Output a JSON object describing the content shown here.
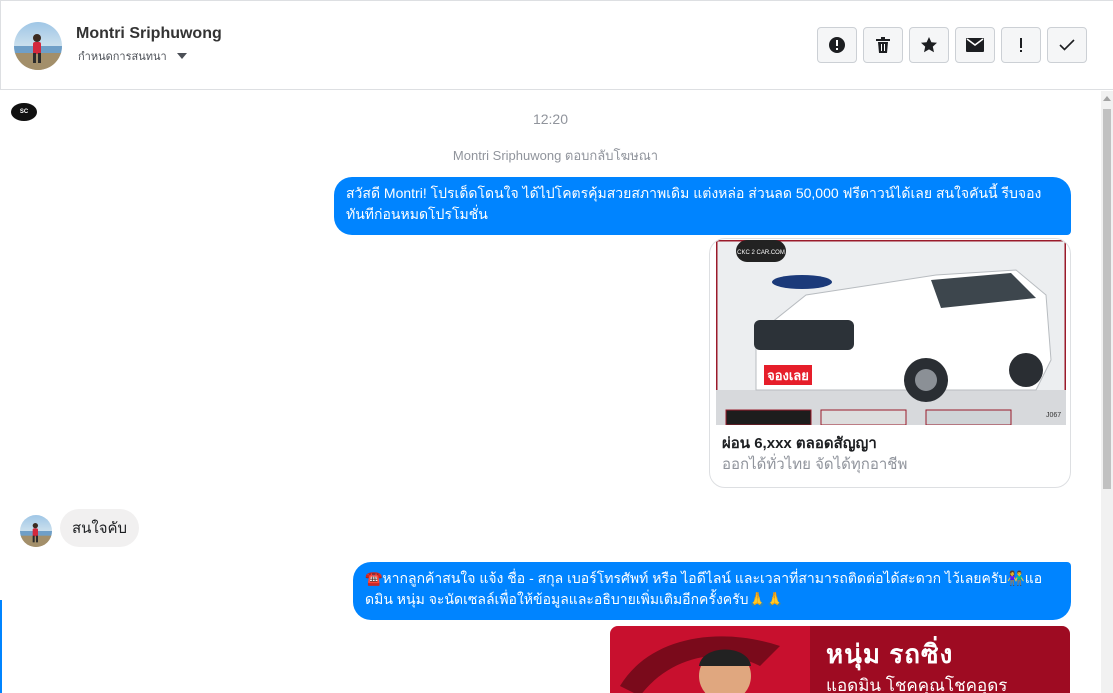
{
  "header": {
    "contact_name": "Montri Sriphuwong",
    "assign_label": "กำหนดการสนทนา",
    "actions": [
      "alert-icon",
      "trash-icon",
      "star-icon",
      "envelope-icon",
      "exclamation-icon",
      "check-icon"
    ]
  },
  "thread": {
    "page_logo": "SC",
    "time": "12:20",
    "reply_note": "Montri Sriphuwong ตอบกลับโฆษณา",
    "message1": "สวัสดี Montri! โปรเด็ดโดนใจ ได้ไปโคตรคุ้มสวยสภาพเดิม แต่งหล่อ  ส่วนลด 50,000 ฟรีดาวน์ได้เลย  สนใจคันนี้ รีบจองทันทีก่อนหมดโปรโมชั่น",
    "card": {
      "image_badge": "จองเลย",
      "image_watermark": "CKC 2 CAR.COM",
      "image_code": "J067",
      "title": "ผ่อน 6,xxx ตลอดสัญญา",
      "subtitle": "ออกได้ทั่วไทย จัดได้ทุกอาชีพ"
    },
    "customer_reply": "สนใจคับ",
    "message2": "☎️หากลูกค้าสนใจ แจ้ง ชื่อ - สกุล เบอร์โทรศัพท์ หรือ ไอดีไลน์ และเวลาที่สามารถติดต่อได้สะดวก ไว้เลยครับ👫แอดมิน หนุ่ม จะนัดเซลล์เพื่อให้ข้อมูลและอธิบายเพิ่มเติมอีกครั้งครับ🙏🙏",
    "promo": {
      "title": "หนุ่ม รถซิ่ง",
      "subtitle": "แอดมิน โชคคุณโชคอุดร"
    }
  },
  "colors": {
    "accent": "#0084ff",
    "incoming_bubble": "#f1f0f0",
    "muted_text": "#90949c",
    "promo_red": "#c8102e"
  }
}
